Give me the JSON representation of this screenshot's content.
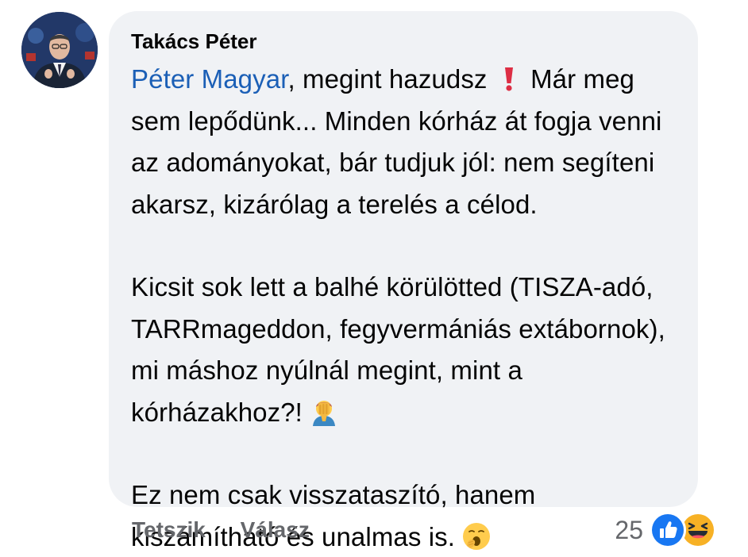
{
  "comment": {
    "author": "Takács Péter",
    "mention": "Péter Magyar",
    "line1_rest": ", megint hazudsz",
    "line1_after": " Már meg sem lepődünk... Minden kórház át fogja venni az adományokat, bár tudjuk jól: nem segíteni akarsz, kizárólag a terelés a célod.",
    "para2": "Kicsit sok lett a balhé körülötted (TISZA-adó, TARRmageddon, fegyvermániás extábornok), mi máshoz nyúlnál megint, mint a kórházakhoz?!",
    "para3": "Ez nem csak visszataszító, hanem kiszámítható és unalmas is.",
    "emojis": {
      "exclamation": "red-exclamation-icon",
      "facepalm": "facepalm-icon",
      "yawn": "yawning-face-icon"
    }
  },
  "actions": {
    "like": "Tetszik",
    "reply": "Válasz"
  },
  "reactions": {
    "count": "25",
    "icons": [
      "like-reaction-icon",
      "haha-reaction-icon"
    ]
  },
  "colors": {
    "bubble": "#f0f2f5",
    "mention": "#1b5fb6",
    "muted": "#65676b",
    "like_blue": "#1877f2"
  }
}
